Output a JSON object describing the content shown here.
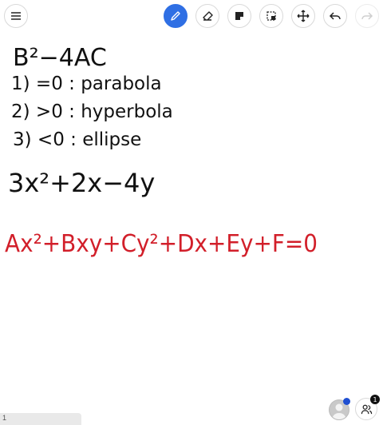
{
  "toolbar": {
    "items": [
      {
        "name": "menu-icon",
        "active": false,
        "disabled": false
      },
      {
        "name": "pen-icon",
        "active": true,
        "disabled": false
      },
      {
        "name": "eraser-icon",
        "active": false,
        "disabled": false
      },
      {
        "name": "sticky-note-icon",
        "active": false,
        "disabled": false
      },
      {
        "name": "select-icon",
        "active": false,
        "disabled": false
      },
      {
        "name": "move-icon",
        "active": false,
        "disabled": false
      },
      {
        "name": "undo-icon",
        "active": false,
        "disabled": false
      },
      {
        "name": "redo-icon",
        "active": false,
        "disabled": true
      }
    ],
    "accent": "#2f6fe4"
  },
  "canvas": {
    "ink_colors": {
      "black": "#111111",
      "red": "#d21f2a"
    },
    "lines": [
      {
        "text": "B²−4AC",
        "color": "black"
      },
      {
        "text": "1) =0 : parabola",
        "color": "black"
      },
      {
        "text": "2) >0 : hyperbola",
        "color": "black"
      },
      {
        "text": "3) <0 : ellipse",
        "color": "black"
      },
      {
        "text": "3x²+2x−4y",
        "color": "black"
      },
      {
        "text": "Ax²+Bxy+Cy²+Dx+Ey+F=0",
        "color": "red"
      }
    ]
  },
  "footer": {
    "page_number": "1",
    "participant_count": "1",
    "presence_color": "#1f4fd1"
  }
}
